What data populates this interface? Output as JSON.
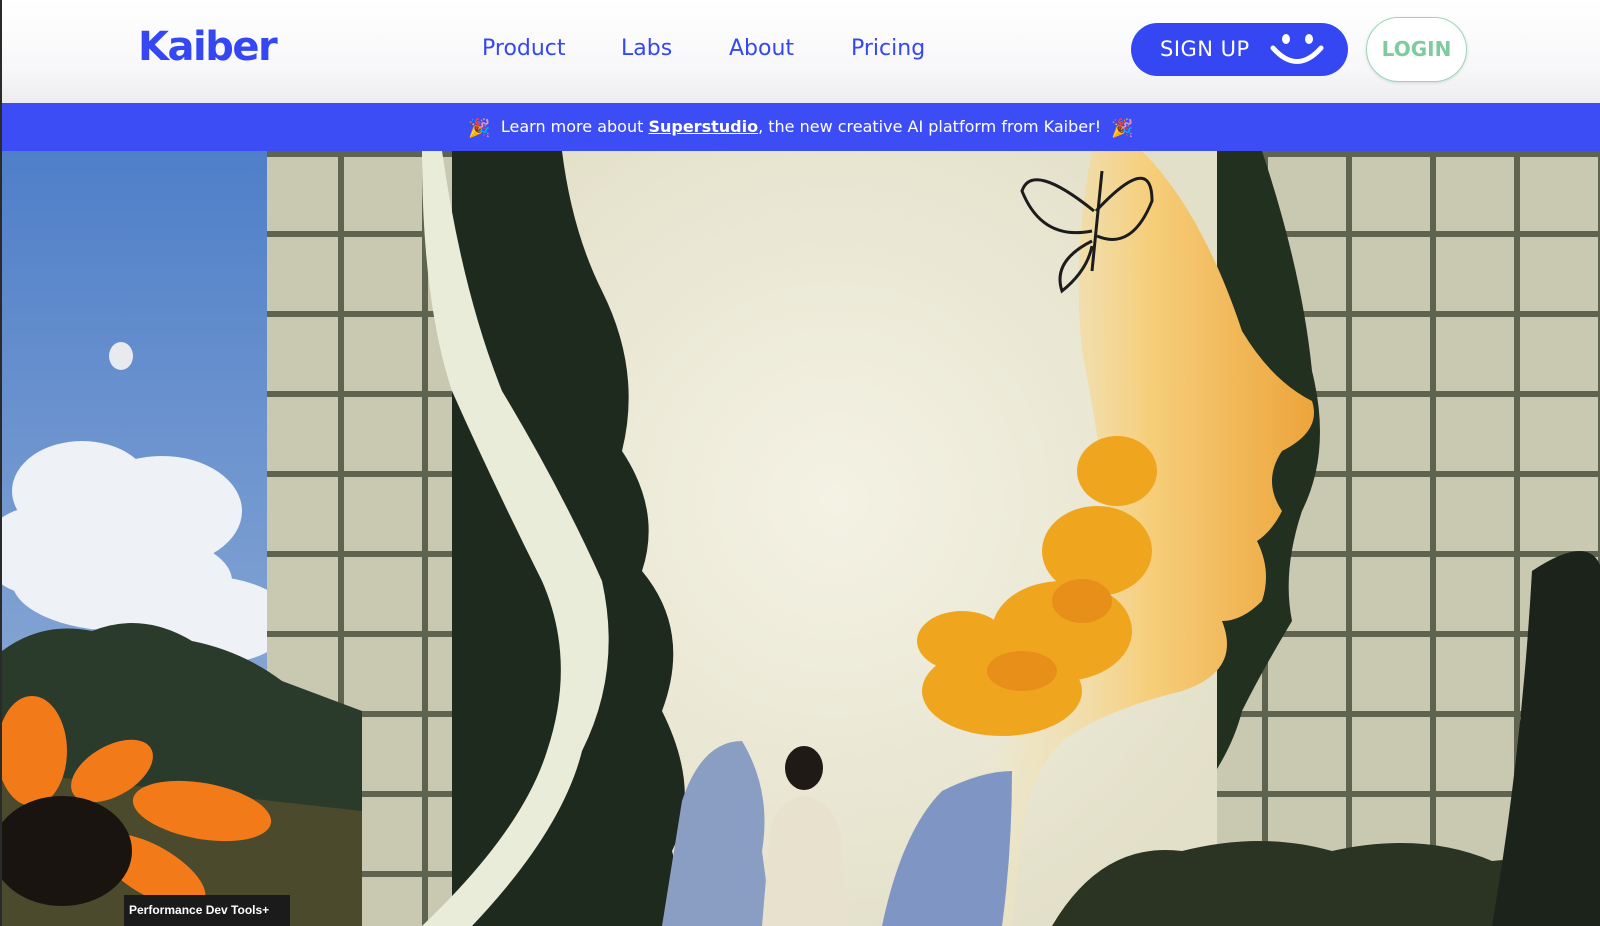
{
  "header": {
    "logo": "Kaiber",
    "nav": [
      "Product",
      "Labs",
      "About",
      "Pricing"
    ],
    "signup_label": "SIGN UP",
    "login_label": "LOGIN"
  },
  "banner": {
    "prefix": "Learn more about ",
    "link": "Superstudio",
    "suffix": ", the new creative AI platform from Kaiber!",
    "emoji": "🎉"
  },
  "devtools": {
    "label": "Performance Dev Tools+"
  },
  "colors": {
    "brand": "#3547f3",
    "banner": "#3d4df5",
    "login": "#7fcba0"
  }
}
